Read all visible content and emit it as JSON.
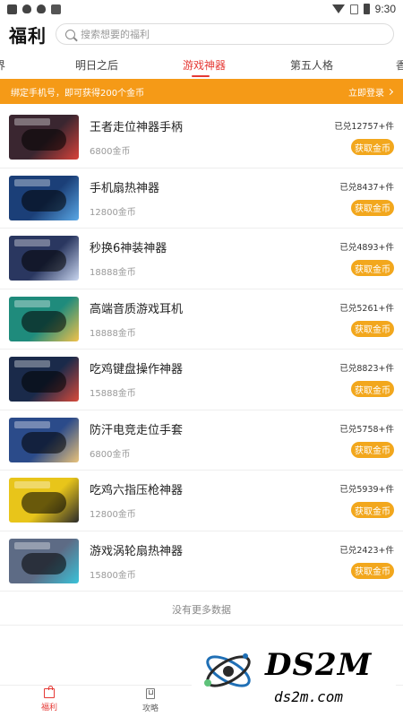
{
  "status_bar": {
    "time": "9:30",
    "left_icons": [
      "image-icon",
      "bug-icon",
      "bug-icon",
      "a-icon"
    ],
    "right_icons": [
      "wifi-icon",
      "nosim-icon",
      "battery-icon"
    ]
  },
  "header": {
    "title": "福利",
    "search_placeholder": "搜索想要的福利"
  },
  "tabs": [
    {
      "label": "界",
      "active": false
    },
    {
      "label": "明日之后",
      "active": false
    },
    {
      "label": "游戏神器",
      "active": true
    },
    {
      "label": "第五人格",
      "active": false
    },
    {
      "label": "香",
      "active": false
    }
  ],
  "banner": {
    "text": "绑定手机号，即可获得200个金币",
    "action": "立即登录"
  },
  "products": [
    {
      "name": "王者走位神器手柄",
      "price": "6800金币",
      "sold": "已兑12757+件",
      "button": "获取金币",
      "thumb_color": "#3a2630",
      "accent": "#d8423a"
    },
    {
      "name": "手机扇热神器",
      "price": "12800金币",
      "sold": "已兑8437+件",
      "button": "获取金币",
      "thumb_color": "#1b3f78",
      "accent": "#5aa8e6"
    },
    {
      "name": "秒换6神装神器",
      "price": "18888金币",
      "sold": "已兑4893+件",
      "button": "获取金币",
      "thumb_color": "#2a3760",
      "accent": "#c9d6f0"
    },
    {
      "name": "高端音质游戏耳机",
      "price": "18888金币",
      "sold": "已兑5261+件",
      "button": "获取金币",
      "thumb_color": "#1f8b7c",
      "accent": "#f2c14a"
    },
    {
      "name": "吃鸡键盘操作神器",
      "price": "15888金币",
      "sold": "已兑8823+件",
      "button": "获取金币",
      "thumb_color": "#1a2a4a",
      "accent": "#d84a3a"
    },
    {
      "name": "防汗电竞走位手套",
      "price": "6800金币",
      "sold": "已兑5758+件",
      "button": "获取金币",
      "thumb_color": "#2b4b8a",
      "accent": "#e9c27a"
    },
    {
      "name": "吃鸡六指压枪神器",
      "price": "12800金币",
      "sold": "已兑5939+件",
      "button": "获取金币",
      "thumb_color": "#e8c51a",
      "accent": "#2a2a2a"
    },
    {
      "name": "游戏涡轮扇热神器",
      "price": "15800金币",
      "sold": "已兑2423+件",
      "button": "获取金币",
      "thumb_color": "#5d6b85",
      "accent": "#3ac2d8"
    }
  ],
  "no_more_text": "没有更多数据",
  "bottom_nav": [
    {
      "label": "福利",
      "icon": "gift-icon",
      "active": true
    },
    {
      "label": "攻略",
      "icon": "book-icon",
      "active": false
    }
  ],
  "watermark": {
    "main": "DS2M",
    "sub": "ds2m.com"
  },
  "colors": {
    "accent_red": "#e53935",
    "banner_orange": "#f59a17",
    "button_gold": "#f2a71d"
  }
}
